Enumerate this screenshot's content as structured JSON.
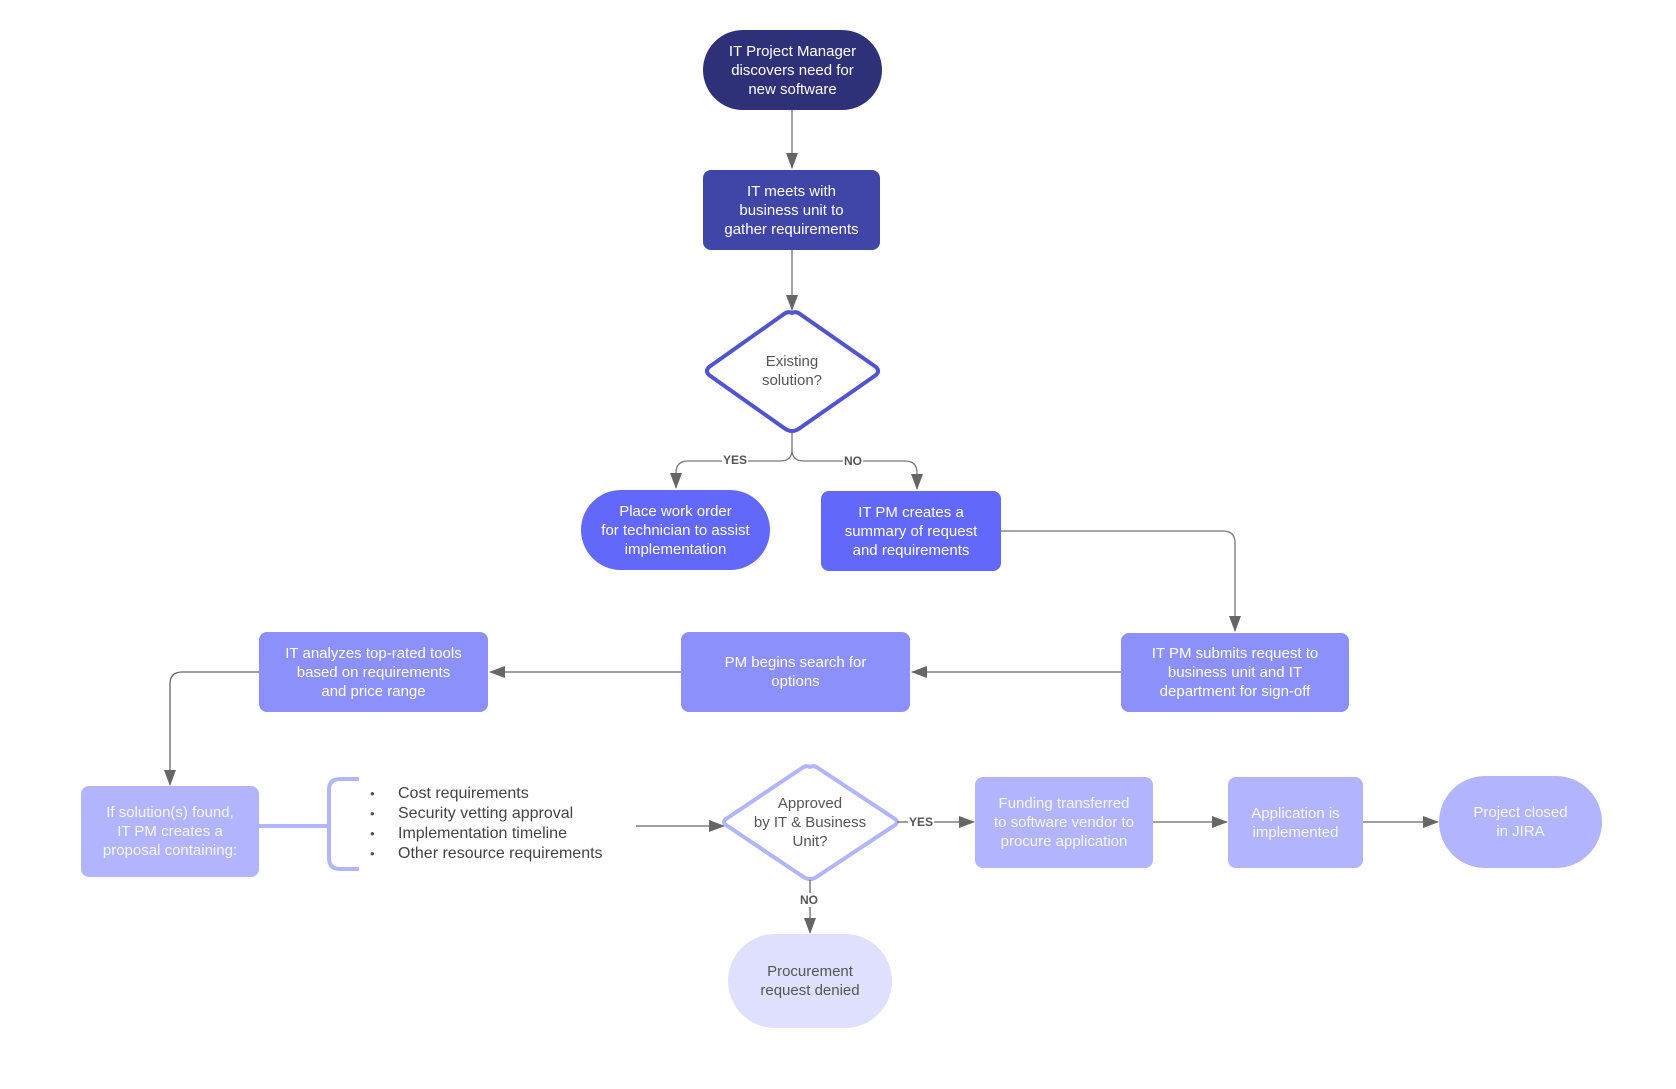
{
  "diagram": {
    "type": "flowchart",
    "colors": {
      "navy": "#2f3178",
      "indigo": "#4045a8",
      "blue": "#6268fa",
      "periwinkle": "#8b90fb",
      "lavender": "#b2b5fd",
      "pale": "#dfe0fd",
      "connector": "#666666"
    },
    "nodes": {
      "start": {
        "label": "IT Project Manager\ndiscovers need for\nnew software",
        "shape": "terminal"
      },
      "meet": {
        "label": "IT meets with\nbusiness unit to\ngather requirements",
        "shape": "process"
      },
      "existing": {
        "label": "Existing\nsolution?",
        "shape": "decision"
      },
      "work_order": {
        "label": "Place work order\nfor technician to assist\nimplementation",
        "shape": "terminal"
      },
      "summary": {
        "label": "IT PM creates a\nsummary of request\nand requirements",
        "shape": "process"
      },
      "submit": {
        "label": "IT PM submits request to\nbusiness unit and IT\ndepartment for sign-off",
        "shape": "process"
      },
      "search": {
        "label": "PM begins search for\noptions",
        "shape": "process"
      },
      "analyze": {
        "label": "IT analyzes top-rated tools\nbased on requirements\nand price range",
        "shape": "process"
      },
      "proposal": {
        "label": "If solution(s) found,\nIT PM creates a\nproposal containing:",
        "shape": "process"
      },
      "approved": {
        "label": "Approved\nby IT & Business\nUnit?",
        "shape": "decision"
      },
      "funding": {
        "label": "Funding transferred\nto software vendor to\nprocure application",
        "shape": "process"
      },
      "implemented": {
        "label": "Application is\nimplemented",
        "shape": "process"
      },
      "closed": {
        "label": "Project closed\nin JIRA",
        "shape": "terminal"
      },
      "denied": {
        "label": "Procurement\nrequest denied",
        "shape": "terminal"
      }
    },
    "proposal_items": [
      "Cost requirements",
      "Security vetting approval",
      "Implementation timeline",
      "Other resource requirements"
    ],
    "edges": [
      {
        "from": "start",
        "to": "meet",
        "label": ""
      },
      {
        "from": "meet",
        "to": "existing",
        "label": ""
      },
      {
        "from": "existing",
        "to": "work_order",
        "label": "YES"
      },
      {
        "from": "existing",
        "to": "summary",
        "label": "NO"
      },
      {
        "from": "summary",
        "to": "submit",
        "label": ""
      },
      {
        "from": "submit",
        "to": "search",
        "label": ""
      },
      {
        "from": "search",
        "to": "analyze",
        "label": ""
      },
      {
        "from": "analyze",
        "to": "proposal",
        "label": ""
      },
      {
        "from": "proposal",
        "to": "approved",
        "label": ""
      },
      {
        "from": "approved",
        "to": "funding",
        "label": "YES"
      },
      {
        "from": "approved",
        "to": "denied",
        "label": "NO"
      },
      {
        "from": "funding",
        "to": "implemented",
        "label": ""
      },
      {
        "from": "implemented",
        "to": "closed",
        "label": ""
      }
    ],
    "edge_labels": {
      "yes": "YES",
      "no": "NO"
    }
  }
}
